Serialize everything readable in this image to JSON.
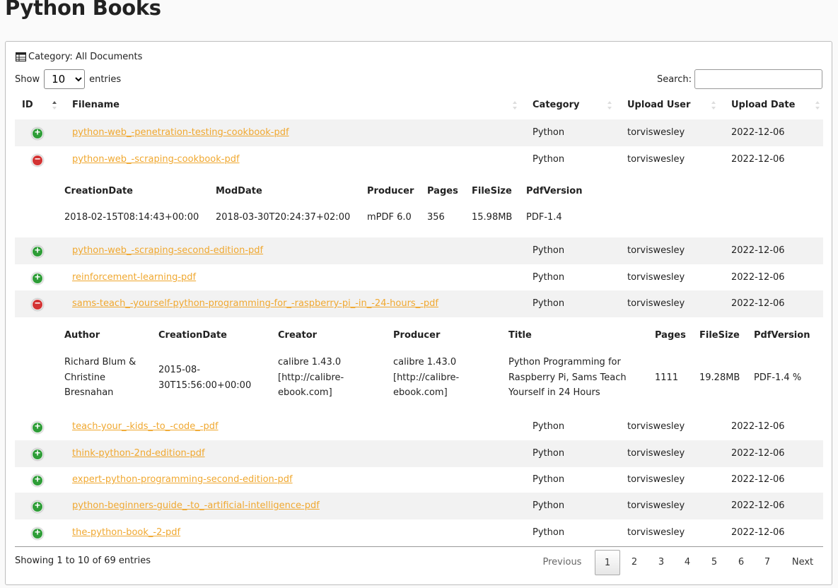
{
  "page": {
    "title": "Python Books"
  },
  "toolbar": {
    "category_label": "Category:",
    "category_value": "All Documents",
    "show_label": "Show",
    "entries_label": "entries",
    "page_length": "10",
    "search_label": "Search:",
    "search_value": ""
  },
  "columns": {
    "id": "ID",
    "filename": "Filename",
    "category": "Category",
    "upload_user": "Upload User",
    "upload_date": "Upload Date"
  },
  "rows": [
    {
      "filename": "python-web_-penetration-testing-cookbook-pdf",
      "category": "Python",
      "user": "torviswesley",
      "date": "2022-12-06",
      "expanded": false
    },
    {
      "filename": "python-web_-scraping-cookbook-pdf",
      "category": "Python",
      "user": "torviswesley",
      "date": "2022-12-06",
      "expanded": true
    },
    {
      "filename": "python-web_-scraping-second-edition-pdf",
      "category": "Python",
      "user": "torviswesley",
      "date": "2022-12-06",
      "expanded": false
    },
    {
      "filename": "reinforcement-learning-pdf",
      "category": "Python",
      "user": "torviswesley",
      "date": "2022-12-06",
      "expanded": false
    },
    {
      "filename": "sams-teach_-yourself-python-programming-for_-raspberry-pi_-in_-24-hours_-pdf",
      "category": "Python",
      "user": "torviswesley",
      "date": "2022-12-06",
      "expanded": true
    },
    {
      "filename": "teach-your_-kids_-to_-code_-pdf",
      "category": "Python",
      "user": "torviswesley",
      "date": "2022-12-06",
      "expanded": false
    },
    {
      "filename": "think-python-2nd-edition-pdf",
      "category": "Python",
      "user": "torviswesley",
      "date": "2022-12-06",
      "expanded": false
    },
    {
      "filename": "expert-python-programming-second-edition-pdf",
      "category": "Python",
      "user": "torviswesley",
      "date": "2022-12-06",
      "expanded": false
    },
    {
      "filename": "python-beginners-guide_-to_-artificial-intelligence-pdf",
      "category": "Python",
      "user": "torviswesley",
      "date": "2022-12-06",
      "expanded": false
    },
    {
      "filename": "the-python-book_-2-pdf",
      "category": "Python",
      "user": "torviswesley",
      "date": "2022-12-06",
      "expanded": false
    }
  ],
  "details": {
    "scraping": {
      "headers": [
        "CreationDate",
        "ModDate",
        "Producer",
        "Pages",
        "FileSize",
        "PdfVersion"
      ],
      "values": [
        "2018-02-15T08:14:43+00:00",
        "2018-03-30T20:24:37+02:00",
        "mPDF 6.0",
        "356",
        "15.98MB",
        "PDF-1.4"
      ]
    },
    "sams": {
      "headers": [
        "Author",
        "CreationDate",
        "Creator",
        "Producer",
        "Title",
        "Pages",
        "FileSize",
        "PdfVersion"
      ],
      "values": [
        [
          "Richard Blum &",
          "Christine",
          "Bresnahan"
        ],
        [
          "2015-08-",
          "30T15:56:00+00:00"
        ],
        [
          "calibre 1.43.0",
          "[http://calibre-",
          "ebook.com]"
        ],
        [
          "calibre 1.43.0",
          "[http://calibre-",
          "ebook.com]"
        ],
        [
          "Python Programming for",
          "Raspberry Pi, Sams Teach",
          "Yourself in 24 Hours"
        ],
        [
          "1111"
        ],
        [
          "19.28MB"
        ],
        [
          "PDF-1.4 %"
        ]
      ]
    }
  },
  "footer": {
    "info": "Showing 1 to 10 of 69 entries",
    "previous": "Previous",
    "pages": [
      "1",
      "2",
      "3",
      "4",
      "5",
      "6",
      "7"
    ],
    "current_page": "1",
    "next": "Next"
  }
}
